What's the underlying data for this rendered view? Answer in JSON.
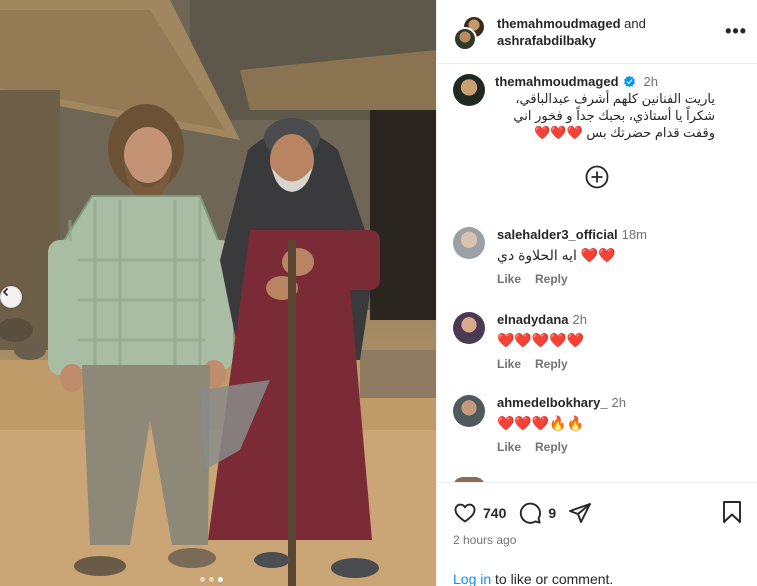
{
  "post": {
    "header": {
      "author1": "themahmoudmaged",
      "joiner": "and",
      "author2": "ashrafabdilbaky",
      "more_icon": "more-horizontal-icon"
    },
    "caption": {
      "username": "themahmoudmaged",
      "time": "2h",
      "text": "ياريت الفنانين كلهم أشرف عبدالباقي، شكراً يا أستاذي، بحبك جداً و فخور اني وقفت قدام حضرتك بس",
      "hearts": "❤️❤️❤️"
    },
    "comments": [
      {
        "username": "salehalder3_official",
        "time": "18m",
        "text": "ايه الحلاوة دي",
        "emojis": "❤️❤️",
        "like": "Like",
        "reply": "Reply"
      },
      {
        "username": "elnadydana",
        "time": "2h",
        "text": "",
        "emojis": "❤️❤️❤️❤️❤️",
        "like": "Like",
        "reply": "Reply"
      },
      {
        "username": "ahmedelbokhary_",
        "time": "2h",
        "text": "",
        "emojis": "❤️❤️❤️🔥🔥",
        "like": "Like",
        "reply": "Reply"
      }
    ],
    "likes_count": "740",
    "comments_count": "9",
    "posted_ago": "2 hours ago",
    "login": {
      "link": "Log in",
      "rest": " to like or comment."
    },
    "carousel": {
      "current_index": 2,
      "total": 3
    }
  },
  "colors": {
    "link": "#0095f6",
    "verified": "#0095f6",
    "heart": "#e0142f",
    "muted": "#737373"
  }
}
